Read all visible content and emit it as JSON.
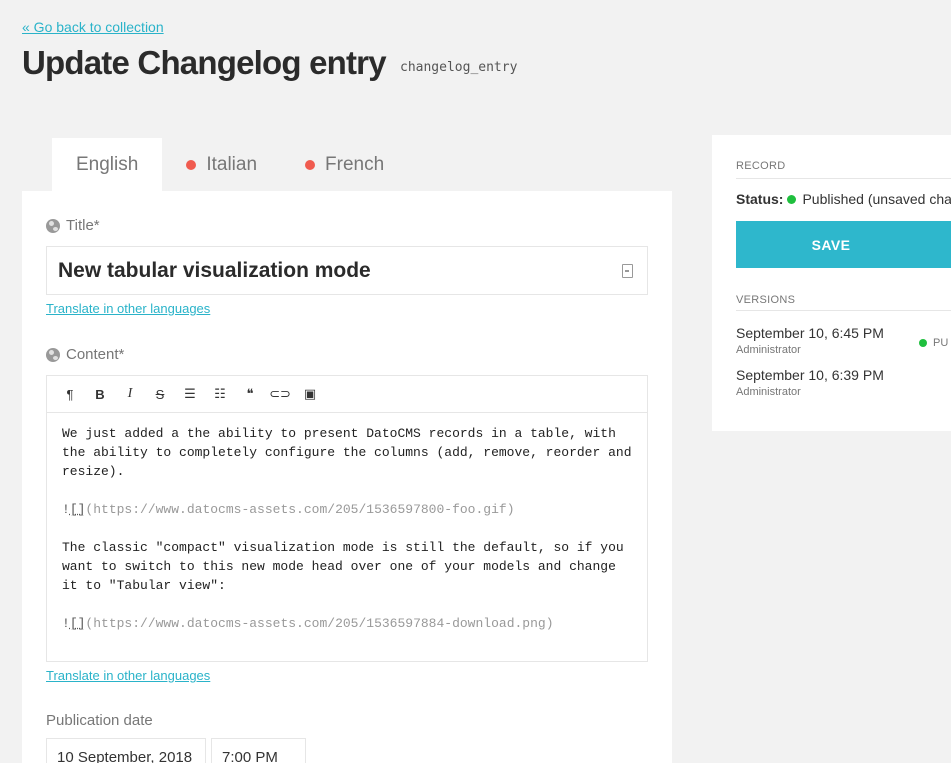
{
  "header": {
    "back_link": "« Go back to collection",
    "title": "Update Changelog entry",
    "api_key": "changelog_entry"
  },
  "tabs": [
    {
      "label": "English",
      "active": true,
      "has_error": false
    },
    {
      "label": "Italian",
      "active": false,
      "has_error": true
    },
    {
      "label": "French",
      "active": false,
      "has_error": true
    }
  ],
  "form": {
    "title_field": {
      "label": "Title*",
      "value": "New tabular visualization mode",
      "translate_link": "Translate in other languages"
    },
    "content_field": {
      "label": "Content*",
      "toolbar": [
        "paragraph-icon",
        "bold-icon",
        "italic-icon",
        "strikethrough-icon",
        "bullet-list-icon",
        "numbered-list-icon",
        "quote-icon",
        "link-icon",
        "image-icon"
      ],
      "toolbar_glyphs": {
        "paragraph": "¶",
        "bold": "B",
        "italic": "I",
        "strike": "S",
        "bullets": "☰",
        "numbers": "☷",
        "quote": "❝",
        "link": "⊂⊃",
        "image": "▣"
      },
      "paragraph1": "We just added a the ability to present DatoCMS records in a table, with\nthe ability to completely configure the columns (add, remove, reorder and\nresize).",
      "image1_bang": "!",
      "image1_brackets": "[]",
      "image1_url": "(https://www.datocms-assets.com/205/1536597800-foo.gif)",
      "paragraph2": "The classic \"compact\" visualization mode is still the default, so if you\nwant to switch to this new mode head over one of your models and change\nit to \"Tabular view\":",
      "image2_bang": "!",
      "image2_brackets": "[]",
      "image2_url": "(https://www.datocms-assets.com/205/1536597884-download.png)",
      "translate_link": "Translate in other languages"
    },
    "publication_date": {
      "label": "Publication date",
      "date": "10 September, 2018",
      "time": "7:00 PM"
    }
  },
  "sidebar": {
    "record_heading": "RECORD",
    "status_label": "Status:",
    "status_value": "Published (unsaved cha",
    "status_color": "#1fbf3e",
    "save_label": "SAVE",
    "versions_heading": "VERSIONS",
    "versions": [
      {
        "date": "September 10, 6:45 PM",
        "author": "Administrator",
        "badge": "PU"
      },
      {
        "date": "September 10, 6:39 PM",
        "author": "Administrator",
        "badge": ""
      }
    ]
  },
  "colors": {
    "accent": "#2eb7cc",
    "error_dot": "#f05b4f",
    "published": "#1fbf3e"
  }
}
